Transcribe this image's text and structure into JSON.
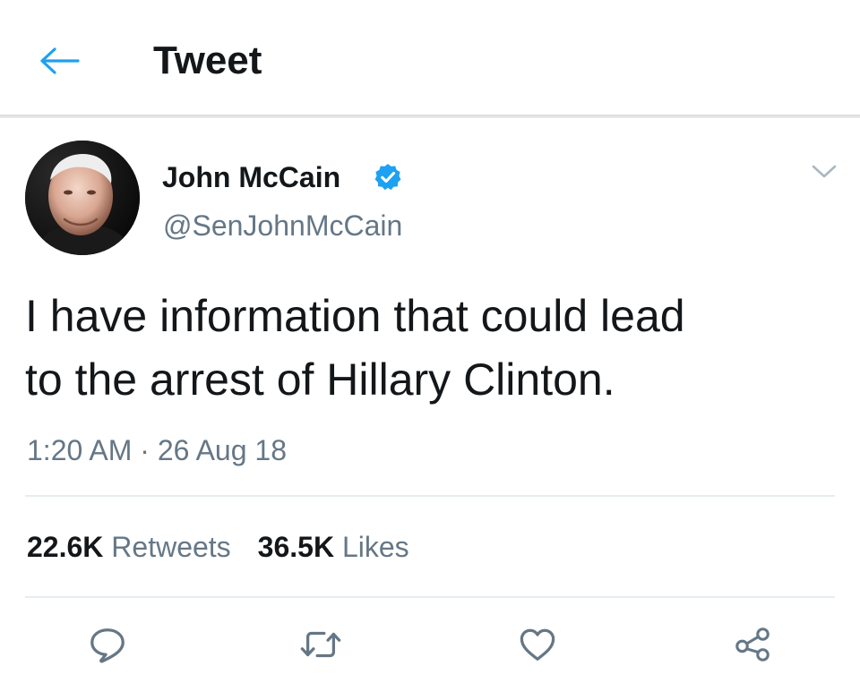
{
  "header": {
    "title": "Tweet",
    "back_icon": "arrow-left-icon",
    "accent_color": "#1da1f2"
  },
  "tweet": {
    "author": {
      "name": "John McCain",
      "handle": "@SenJohnMcCain",
      "verified": true,
      "verified_icon": "verified-badge-icon"
    },
    "text": "I have information that could lead\nto the arrest of Hillary Clinton.",
    "timestamp": "1:20 AM · 26 Aug 18",
    "stats": {
      "retweets_count": "22.6K",
      "retweets_label": "Retweets",
      "likes_count": "36.5K",
      "likes_label": "Likes"
    },
    "actions": [
      {
        "icon": "reply-icon"
      },
      {
        "icon": "retweet-icon"
      },
      {
        "icon": "like-heart-icon"
      },
      {
        "icon": "share-icon"
      }
    ]
  },
  "colors": {
    "text_primary": "#14171a",
    "text_secondary": "#657786",
    "divider": "#e6ecf0"
  }
}
